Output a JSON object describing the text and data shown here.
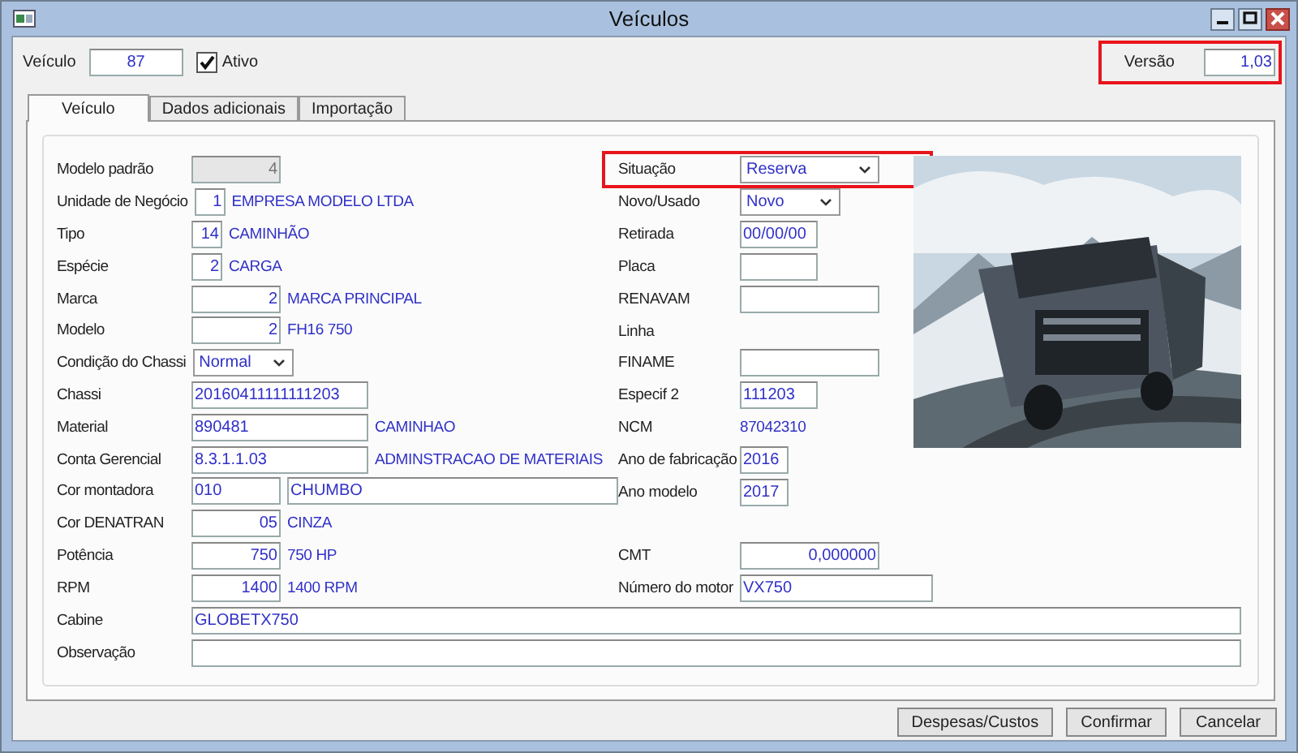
{
  "window": {
    "title": "Veículos"
  },
  "header": {
    "vehicle": {
      "label": "Veículo",
      "value": "87"
    },
    "active": {
      "label": "Ativo",
      "checked": true
    },
    "version": {
      "label": "Versão",
      "value": "1,03",
      "highlighted": true
    }
  },
  "tabs": [
    {
      "label": "Veículo",
      "selected": true
    },
    {
      "label": "Dados adicionais",
      "selected": false
    },
    {
      "label": "Importação",
      "selected": false
    }
  ],
  "left_fields": [
    {
      "label": "Modelo padrão",
      "parts": [
        {
          "kind": "num",
          "value": "4",
          "disabled": true
        }
      ]
    },
    {
      "label": "Unidade de Negócio",
      "parts": [
        {
          "kind": "tiny",
          "value": "1",
          "disabled": false
        },
        {
          "kind": "link",
          "value": "EMPRESA MODELO LTDA"
        }
      ]
    },
    {
      "label": "Tipo",
      "parts": [
        {
          "kind": "tiny",
          "value": "14",
          "disabled": false
        },
        {
          "kind": "link",
          "value": "CAMINHÃO"
        }
      ]
    },
    {
      "label": "Espécie",
      "parts": [
        {
          "kind": "tiny",
          "value": "2",
          "disabled": false
        },
        {
          "kind": "link",
          "value": "CARGA"
        }
      ]
    },
    {
      "label": "Marca",
      "parts": [
        {
          "kind": "num",
          "value": "2",
          "disabled": false
        },
        {
          "kind": "link",
          "value": "MARCA PRINCIPAL"
        }
      ]
    },
    {
      "label": "Modelo",
      "parts": [
        {
          "kind": "num",
          "value": "2",
          "disabled": false
        },
        {
          "kind": "link",
          "value": "FH16 750"
        }
      ]
    },
    {
      "label": "Condição do Chassi",
      "parts": [
        {
          "kind": "select",
          "value": "Normal"
        }
      ]
    },
    {
      "label": "Chassi",
      "parts": [
        {
          "kind": "text",
          "value": "20160411111111203",
          "disabled": false
        }
      ]
    },
    {
      "label": "Material",
      "parts": [
        {
          "kind": "text",
          "value": "890481",
          "disabled": false
        },
        {
          "kind": "link",
          "value": "CAMINHAO"
        }
      ]
    },
    {
      "label": "Conta Gerencial",
      "parts": [
        {
          "kind": "text",
          "value": "8.3.1.1.03",
          "disabled": false
        },
        {
          "kind": "link",
          "value": "ADMINSTRACAO DE MATERIAIS"
        }
      ]
    },
    {
      "label": "Cor montadora",
      "parts": [
        {
          "kind": "code",
          "value": "010",
          "disabled": false
        },
        {
          "kind": "long",
          "value": "CHUMBO",
          "disabled": false
        }
      ]
    },
    {
      "label": "Cor DENATRAN",
      "parts": [
        {
          "kind": "num",
          "value": "05",
          "disabled": false
        },
        {
          "kind": "link",
          "value": "CINZA"
        }
      ]
    },
    {
      "label": "Potência",
      "parts": [
        {
          "kind": "num",
          "value": "750",
          "disabled": false
        },
        {
          "kind": "link",
          "value": "750 HP"
        }
      ]
    },
    {
      "label": "RPM",
      "parts": [
        {
          "kind": "num",
          "value": "1400",
          "disabled": false
        },
        {
          "kind": "link",
          "value": "1400 RPM"
        }
      ]
    }
  ],
  "right_fields": [
    {
      "label": "Situação",
      "highlighted": true,
      "parts": [
        {
          "kind": "combo",
          "value": "Reserva"
        }
      ]
    },
    {
      "label": "Novo/Usado",
      "highlighted": false,
      "parts": [
        {
          "kind": "select",
          "value": "Novo"
        }
      ]
    },
    {
      "label": "Retirada",
      "highlighted": false,
      "parts": [
        {
          "kind": "short",
          "value": "00/00/00",
          "disabled": false
        }
      ]
    },
    {
      "label": "Placa",
      "highlighted": false,
      "parts": [
        {
          "kind": "short",
          "disabled": false
        }
      ]
    },
    {
      "label": "RENAVAM",
      "highlighted": false,
      "parts": [
        {
          "kind": "field",
          "disabled": false
        }
      ]
    },
    {
      "label": "Linha",
      "highlighted": false
    },
    {
      "label": "FINAME",
      "highlighted": false,
      "parts": [
        {
          "kind": "field",
          "disabled": false
        }
      ]
    },
    {
      "label": "Especif 2",
      "highlighted": false,
      "parts": [
        {
          "kind": "short",
          "value": "111203",
          "disabled": false
        }
      ]
    },
    {
      "label": "NCM",
      "highlighted": false,
      "parts": [
        {
          "kind": "link",
          "value": "87042310"
        }
      ]
    },
    {
      "label": "Ano de fabricação",
      "highlighted": false,
      "parts": [
        {
          "kind": "year",
          "value": "2016",
          "disabled": false
        }
      ]
    },
    {
      "label": "Ano modelo",
      "highlighted": false,
      "parts": [
        {
          "kind": "year",
          "value": "2017",
          "disabled": false
        }
      ]
    },
    {
      "label": "CMT",
      "highlighted": false,
      "parts": [
        {
          "kind": "fieldnum",
          "value": "0,000000",
          "disabled": false
        }
      ]
    },
    {
      "label": "Número do motor",
      "highlighted": false,
      "parts": [
        {
          "kind": "motor",
          "value": "VX750",
          "disabled": false
        }
      ]
    }
  ],
  "bottom_fields": [
    {
      "label": "Cabine",
      "value": "GLOBETX750"
    },
    {
      "label": "Observação"
    }
  ],
  "buttons": [
    "Despesas/Custos",
    "Confirmar",
    "Cancelar"
  ]
}
